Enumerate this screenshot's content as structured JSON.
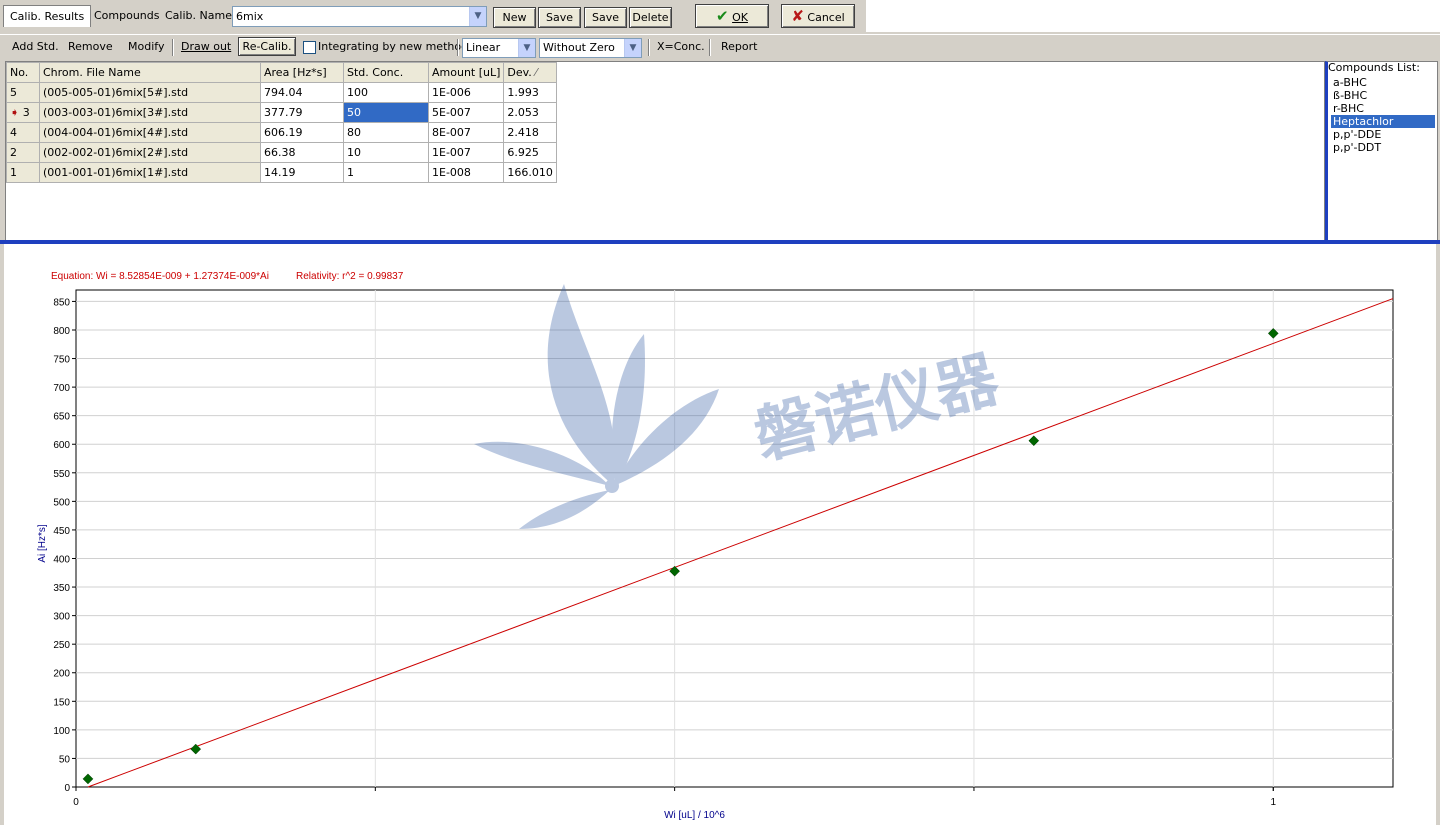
{
  "tabs": [
    {
      "label": "Calib. Results",
      "active": true
    },
    {
      "label": "Compounds",
      "active": false
    }
  ],
  "calib_name": {
    "label": "Calib. Name",
    "value": "6mix"
  },
  "top_buttons": {
    "new": "New",
    "save": "Save",
    "save_as": "Save as",
    "delete": "Delete",
    "ok": "OK",
    "cancel": "Cancel"
  },
  "toolbar": {
    "add_std": "Add Std.",
    "remove": "Remove",
    "modify": "Modify",
    "draw_out": "Draw out",
    "re_calib": "Re-Calib.",
    "integrating_label": "Integrating by new method",
    "integrating_checked": false,
    "fit_type": "Linear",
    "zero_mode": "Without Zero",
    "x_conc": "X=Conc.",
    "report": "Report"
  },
  "table": {
    "headers": [
      "No.",
      "Chrom. File Name",
      "Area [Hz*s]",
      "Std. Conc.",
      "Amount [uL]",
      "Dev."
    ],
    "rows": [
      {
        "no": "5",
        "file": "(005-005-01)6mix[5#].std",
        "area": "794.04",
        "conc": "100",
        "amount": "1E-006",
        "dev": "1.993",
        "current": false
      },
      {
        "no": "3",
        "file": "(003-003-01)6mix[3#].std",
        "area": "377.79",
        "conc": "50",
        "amount": "5E-007",
        "dev": "2.053",
        "current": true
      },
      {
        "no": "4",
        "file": "(004-004-01)6mix[4#].std",
        "area": "606.19",
        "conc": "80",
        "amount": "8E-007",
        "dev": "2.418",
        "current": false
      },
      {
        "no": "2",
        "file": "(002-002-01)6mix[2#].std",
        "area": "66.38",
        "conc": "10",
        "amount": "1E-007",
        "dev": "6.925",
        "current": false
      },
      {
        "no": "1",
        "file": "(001-001-01)6mix[1#].std",
        "area": "14.19",
        "conc": "1",
        "amount": "1E-008",
        "dev": "166.010",
        "current": false
      }
    ]
  },
  "compounds": {
    "title": "Compounds List:",
    "items": [
      "a-BHC",
      "ß-BHC",
      "r-BHC",
      "Heptachlor",
      "p,p'-DDE",
      "p,p'-DDT"
    ],
    "selected": "Heptachlor"
  },
  "chart_header": {
    "equation": "Equation: Wi = 8.52854E-009 + 1.27374E-009*Ai",
    "relativity": "Relativity: r^2 = 0.99837"
  },
  "watermark": {
    "text": "磐诺仪器"
  },
  "colors": {
    "line": "#cc0000",
    "points": "#006600",
    "axis_label": "#00008b",
    "selection": "#316ac5",
    "accent_border": "#1e3fbf"
  },
  "chart_data": {
    "type": "scatter",
    "xlabel": "Wi [uL] / 10^6",
    "ylabel": "Ai [Hz*s]",
    "xlim": [
      0,
      1.1
    ],
    "ylim": [
      0,
      870
    ],
    "x_ticks": [
      0,
      1
    ],
    "y_ticks": [
      0,
      50,
      100,
      150,
      200,
      250,
      300,
      350,
      400,
      450,
      500,
      550,
      600,
      650,
      700,
      750,
      800,
      850
    ],
    "grid": true,
    "series": [
      {
        "values": [
          {
            "x": 0.01,
            "y": 14.19
          },
          {
            "x": 0.1,
            "y": 66.38
          },
          {
            "x": 0.5,
            "y": 377.79
          },
          {
            "x": 0.8,
            "y": 606.19
          },
          {
            "x": 1.0,
            "y": 794.04
          }
        ]
      }
    ],
    "fit_line": {
      "x": [
        0.01,
        1.1
      ],
      "y": [
        0,
        855
      ]
    }
  }
}
